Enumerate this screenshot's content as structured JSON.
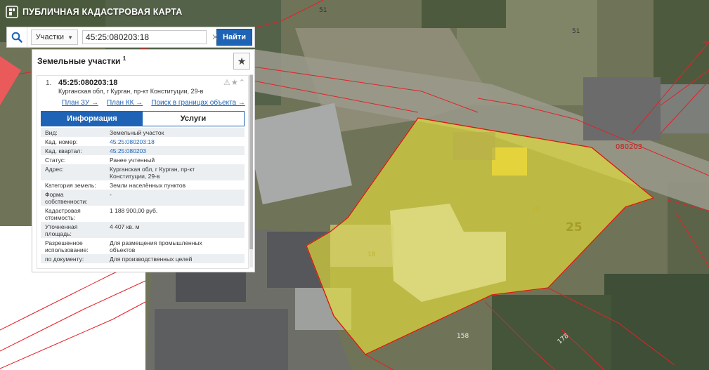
{
  "app": {
    "title": "ПУБЛИЧНАЯ КАДАСТРОВАЯ КАРТА"
  },
  "search": {
    "type_label": "Участки",
    "query": "45:25:080203:18",
    "find_label": "Найти"
  },
  "panel": {
    "title": "Земельные участки",
    "count": "1",
    "item": {
      "number": "1.",
      "cad_number": "45:25:080203:18",
      "address_line1": "Курганская обл, г Курган, пр-кт Конституции, 29-в",
      "links": [
        "План ЗУ →",
        "План КК →",
        "Поиск в границах объекта →"
      ]
    },
    "tabs": [
      "Информация",
      "Услуги"
    ],
    "attributes": [
      {
        "k": "Вид:",
        "v": [
          "Земельный участок"
        ]
      },
      {
        "k": "Кад. номер:",
        "v": [
          "45:25:080203:18"
        ],
        "link": true
      },
      {
        "k": "Кад. квартал:",
        "v": [
          "45:25:080203"
        ],
        "link": true
      },
      {
        "k": "Статус:",
        "v": [
          "Ранее учтенный"
        ]
      },
      {
        "k": "Адрес:",
        "v": [
          "Курганская обл, г Курган, пр-кт",
          "Конституции, 29-в"
        ]
      },
      {
        "k": "Категория земель:",
        "v": [
          "Земли населённых пунктов"
        ]
      },
      {
        "k": "Форма|собственности:",
        "v": [
          "-"
        ]
      },
      {
        "k": "Кадастровая|стоимость:",
        "v": [
          "1 188 900,00 руб."
        ]
      },
      {
        "k": "Уточненная|площадь:",
        "v": [
          "4 407 кв. м"
        ]
      },
      {
        "k": "Разрешенное|использование:",
        "v": [
          "Для размещения промышленных",
          "объектов"
        ]
      },
      {
        "k": "по документу:",
        "v": [
          "Для производственных целей"
        ]
      }
    ]
  },
  "map_labels": {
    "l51a": "51",
    "l51b": "51",
    "quarter": "080203",
    "lot18a": "18",
    "lot18b": "18",
    "lot25": "25",
    "lot158": "158",
    "lot178": "178"
  },
  "colors": {
    "accent": "#1e63b5",
    "parcel_fill": "#e5e03a",
    "boundary": "#e0232a"
  }
}
